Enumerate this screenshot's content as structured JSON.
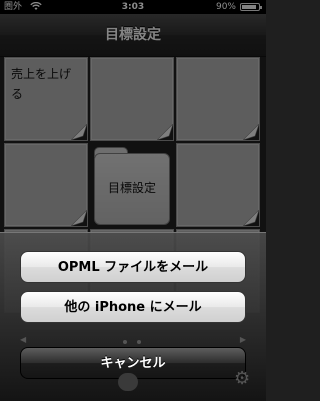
{
  "status": {
    "carrier": "圏外",
    "time": "3:03",
    "battery": "90%",
    "battery_level": 0.9
  },
  "nav": {
    "title": "目標設定"
  },
  "grid": {
    "cell1_label": "売上を上げる",
    "folder_label": "目標設定"
  },
  "action_sheet": {
    "opml_label": "OPML ファイルをメール",
    "other_iphone_label": "他の iPhone にメール",
    "cancel_label": "キャンセル"
  },
  "icons": {
    "wifi": "wifi-icon",
    "battery": "battery-icon",
    "fold": "page-fold-icon",
    "home": "home-icon",
    "gear": "gear-icon"
  }
}
